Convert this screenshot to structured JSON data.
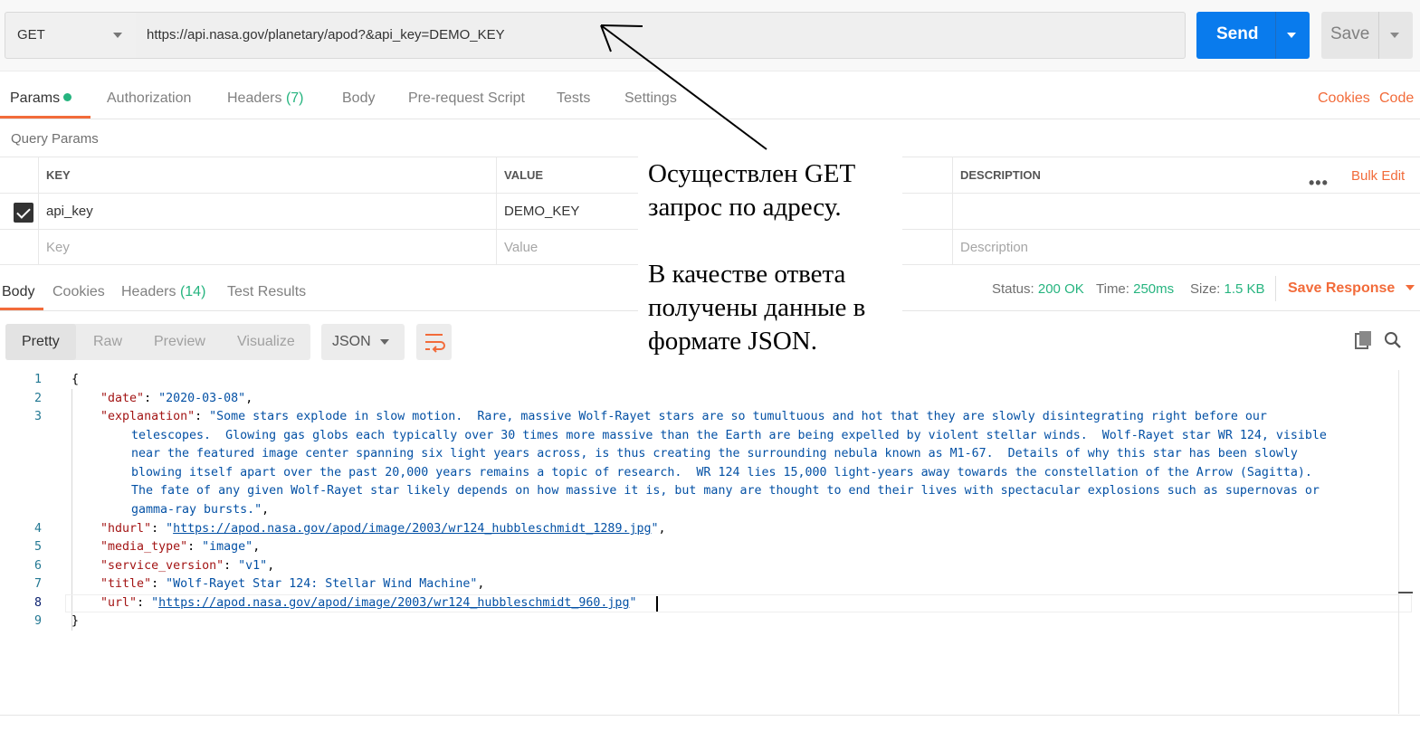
{
  "request": {
    "method": "GET",
    "url": "https://api.nasa.gov/planetary/apod?&api_key=DEMO_KEY",
    "send_label": "Send",
    "save_label": "Save"
  },
  "request_tabs": [
    {
      "label": "Params",
      "active": true,
      "dot": true
    },
    {
      "label": "Authorization"
    },
    {
      "label": "Headers",
      "count": "(7)"
    },
    {
      "label": "Body"
    },
    {
      "label": "Pre-request Script"
    },
    {
      "label": "Tests"
    },
    {
      "label": "Settings"
    }
  ],
  "request_links": {
    "cookies": "Cookies",
    "code": "Code"
  },
  "query_params": {
    "title": "Query Params",
    "headers": {
      "key": "KEY",
      "value": "VALUE",
      "description": "DESCRIPTION"
    },
    "bulk_edit": "Bulk Edit",
    "more": "•••",
    "rows": [
      {
        "key": "api_key",
        "value": "DEMO_KEY",
        "checked": true
      }
    ],
    "placeholders": {
      "key": "Key",
      "value": "Value",
      "description": "Description"
    }
  },
  "response_tabs": [
    {
      "label": "Body",
      "active": true
    },
    {
      "label": "Cookies"
    },
    {
      "label": "Headers",
      "count": "(14)"
    },
    {
      "label": "Test Results"
    }
  ],
  "response_status": {
    "status_label": "Status:",
    "status_value": "200 OK",
    "time_label": "Time:",
    "time_value": "250ms",
    "size_label": "Size:",
    "size_value": "1.5 KB",
    "save_response": "Save Response"
  },
  "view_modes": [
    "Pretty",
    "Raw",
    "Preview",
    "Visualize"
  ],
  "format": "JSON",
  "line_numbers": [
    "1",
    "2",
    "3",
    "4",
    "5",
    "6",
    "7",
    "8",
    "9"
  ],
  "response_json": {
    "date": "2020-03-08",
    "explanation_lines": [
      "\"Some stars explode in slow motion.  Rare, massive Wolf-Rayet stars are so tumultuous and hot that they are slowly disintegrating right before our",
      "telescopes.  Glowing gas globs each typically over 30 times more massive than the Earth are being expelled by violent stellar winds.  Wolf-Rayet star WR 124, visible",
      "near the featured image center spanning six light years across, is thus creating the surrounding nebula known as M1-67.  Details of why this star has been slowly",
      "blowing itself apart over the past 20,000 years remains a topic of research.  WR 124 lies 15,000 light-years away towards the constellation of the Arrow (Sagitta).",
      "The fate of any given Wolf-Rayet star likely depends on how massive it is, but many are thought to end their lives with spectacular explosions such as supernovas or",
      "gamma-ray bursts.\""
    ],
    "hdurl": "https://apod.nasa.gov/apod/image/2003/wr124_hubbleschmidt_1289.jpg",
    "media_type": "image",
    "service_version": "v1",
    "title": "Wolf-Rayet Star 124: Stellar Wind Machine",
    "url": "https://apod.nasa.gov/apod/image/2003/wr124_hubbleschmidt_960.jpg"
  },
  "annotation": {
    "line1": "Осуществлен GET запрос по адресу.",
    "line2": "В качестве ответа получены данные в формате JSON."
  },
  "colors": {
    "accent": "#f26b3a",
    "send": "#097bed",
    "success": "#26b47f"
  }
}
